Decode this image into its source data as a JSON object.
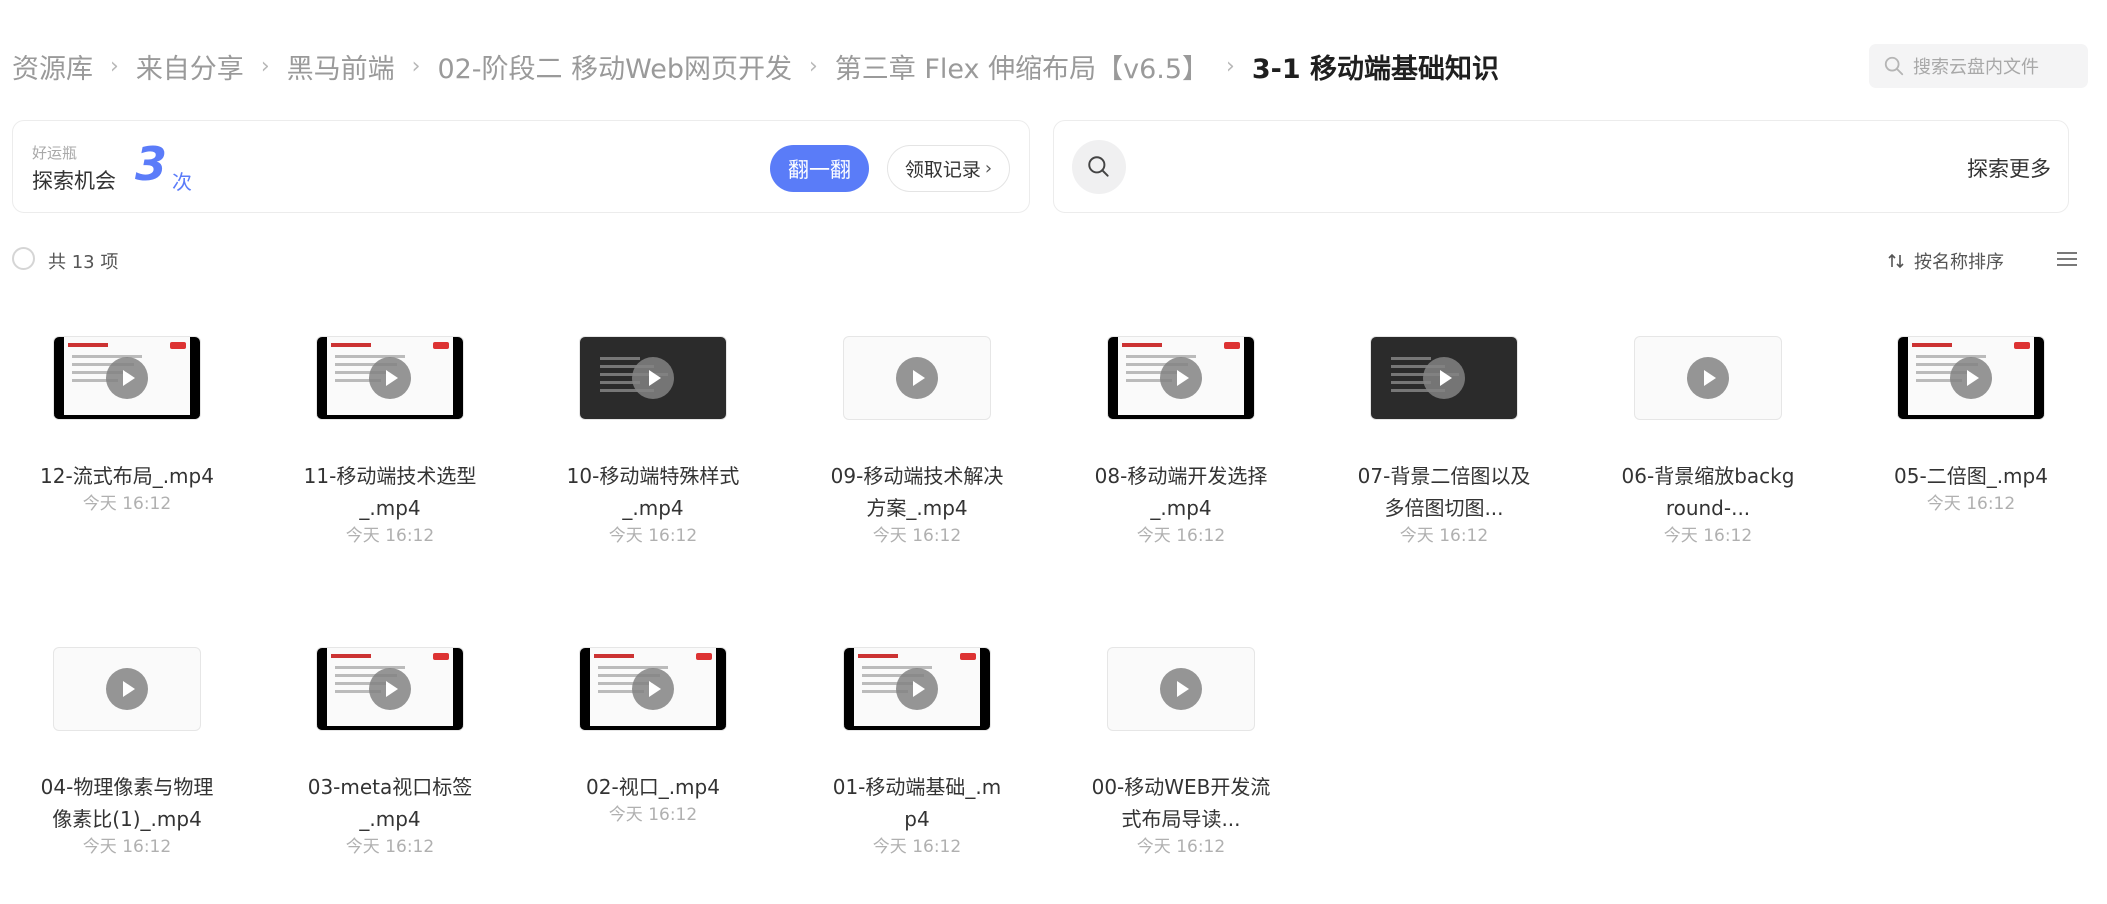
{
  "breadcrumb": {
    "items": [
      "资源库",
      "来自分享",
      "黑马前端",
      "02-阶段二 移动Web网页开发",
      "第三章 Flex 伸缩布局【v6.5】"
    ],
    "current": "3-1 移动端基础知识"
  },
  "search": {
    "placeholder": "搜索云盘内文件"
  },
  "lucky": {
    "title": "好运瓶",
    "explore_label": "探索机会",
    "count": "3",
    "unit": "次",
    "flip_button": "翻一翻",
    "record_button": "领取记录"
  },
  "explore_more": "探索更多",
  "toolbar": {
    "count_text": "共 13 项",
    "sort_label": "按名称排序"
  },
  "files": [
    {
      "name": "12-流式布局_.mp4",
      "date": "今天 16:12",
      "thumb": "slide"
    },
    {
      "name": "11-移动端技术选型_.mp4",
      "date": "今天 16:12",
      "thumb": "slide"
    },
    {
      "name": "10-移动端特殊样式_.mp4",
      "date": "今天 16:12",
      "thumb": "dark"
    },
    {
      "name": "09-移动端技术解决方案_.mp4",
      "date": "今天 16:12",
      "thumb": "light"
    },
    {
      "name": "08-移动端开发选择_.mp4",
      "date": "今天 16:12",
      "thumb": "slide"
    },
    {
      "name": "07-背景二倍图以及多倍图切图...",
      "date": "今天 16:12",
      "thumb": "dark"
    },
    {
      "name": "06-背景缩放background-...",
      "date": "今天 16:12",
      "thumb": "light"
    },
    {
      "name": "05-二倍图_.mp4",
      "date": "今天 16:12",
      "thumb": "slide"
    },
    {
      "name": "04-物理像素与物理像素比(1)_.mp4",
      "date": "今天 16:12",
      "thumb": "light"
    },
    {
      "name": "03-meta视口标签_.mp4",
      "date": "今天 16:12",
      "thumb": "slide"
    },
    {
      "name": "02-视口_.mp4",
      "date": "今天 16:12",
      "thumb": "slide"
    },
    {
      "name": "01-移动端基础_.mp4",
      "date": "今天 16:12",
      "thumb": "slide"
    },
    {
      "name": "00-移动WEB开发流式布局导读...",
      "date": "今天 16:12",
      "thumb": "light"
    }
  ],
  "icons": {
    "search": "search-icon",
    "sort": "sort-icon",
    "list": "list-view-icon",
    "play": "play-icon"
  },
  "colors": {
    "accent": "#5a7cf8",
    "count": "#5b7cf9"
  }
}
